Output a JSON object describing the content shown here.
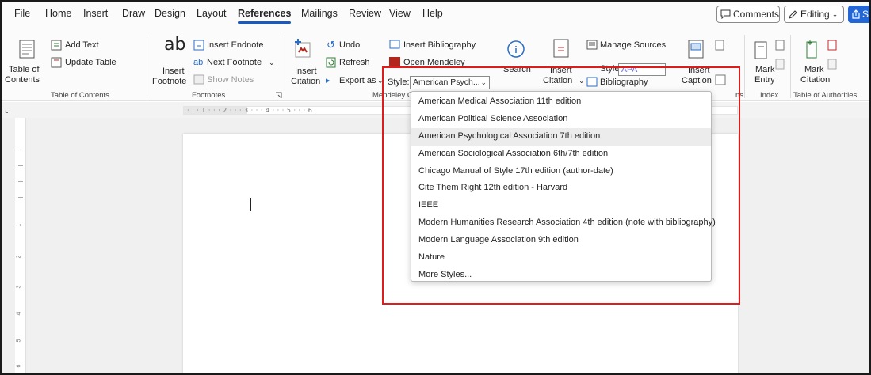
{
  "menu": {
    "tabs": [
      "File",
      "Home",
      "Insert",
      "Draw",
      "Design",
      "Layout",
      "References",
      "Mailings",
      "Review",
      "View",
      "Help"
    ],
    "active_tab": "References",
    "comments_label": "Comments",
    "editing_label": "Editing",
    "share_label": "Sh"
  },
  "ribbon": {
    "toc": {
      "big_label_1": "Table of",
      "big_label_2": "Contents",
      "add_text": "Add Text",
      "update_table": "Update Table",
      "group": "Table of Contents"
    },
    "footnotes": {
      "insert_label_1": "Insert",
      "insert_label_2": "Footnote",
      "insert_endnote": "Insert Endnote",
      "next_footnote": "Next Footnote",
      "show_notes": "Show Notes",
      "group": "Footnotes"
    },
    "mendeley": {
      "insert_label_1": "Insert",
      "insert_label_2": "Citation",
      "undo": "Undo",
      "refresh": "Refresh",
      "export_as": "Export as",
      "insert_bibliography": "Insert Bibliography",
      "open_mendeley": "Open Mendeley",
      "style_label": "Style:",
      "style_value": "American Psych...",
      "group": "Mendeley Cite-O-"
    },
    "search_label": "Search",
    "citations": {
      "insert_label_1": "Insert",
      "insert_label_2": "Citation",
      "manage_sources": "Manage Sources",
      "style_label": "Style:",
      "style_value": "APA",
      "bibliography": "Bibliography"
    },
    "captions": {
      "insert_label_1": "Insert",
      "insert_label_2": "Caption",
      "group_tail": "ns"
    },
    "index": {
      "mark_1": "Mark",
      "mark_2": "Entry",
      "group": "Index"
    },
    "authorities": {
      "mark_1": "Mark",
      "mark_2": "Citation",
      "group": "Table of Authorities"
    }
  },
  "ruler": {
    "marks": "· · · 1 · · · 2 · · · 3 · · · 4 · · · 5 · · · 6"
  },
  "vertical_ruler": {
    "numbers": [
      "1",
      "2",
      "3",
      "4",
      "5",
      "6"
    ]
  },
  "style_dropdown": {
    "selected": "American Psychological Association 7th edition",
    "options": [
      "American Medical Association 11th edition",
      "American Political Science Association",
      "American Psychological Association 7th edition",
      "American Sociological Association 6th/7th edition",
      "Chicago Manual of Style 17th edition (author-date)",
      "Cite Them Right 12th edition - Harvard",
      "IEEE",
      "Modern Humanities Research Association 4th edition (note with bibliography)",
      "Modern Language Association 9th edition",
      "Nature",
      "More Styles..."
    ]
  },
  "colors": {
    "accent": "#185abd",
    "highlight": "#e01b1b",
    "share_button": "#2266d8",
    "mendeley_red": "#b3261e"
  }
}
